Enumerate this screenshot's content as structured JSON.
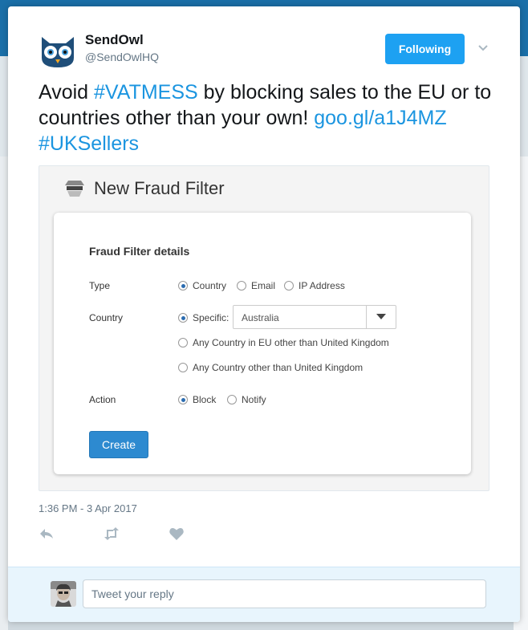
{
  "tweet": {
    "author_name": "SendOwl",
    "author_handle": "@SendOwlHQ",
    "follow_label": "Following",
    "text_part1": "Avoid ",
    "hashtag1": "#VATMESS",
    "text_part2": " by blocking sales to the EU or to countries other than your own! ",
    "link": "goo.gl/a1J4MZ",
    "hashtag2": "#UKSellers",
    "timestamp": "1:36 PM - 3 Apr 2017"
  },
  "media": {
    "title": "New Fraud Filter",
    "section_title": "Fraud Filter details",
    "type_label": "Type",
    "type_options": [
      "Country",
      "Email",
      "IP Address"
    ],
    "country_label": "Country",
    "specific_label": "Specific:",
    "country_value": "Australia",
    "option_eu": "Any Country in EU other than United Kingdom",
    "option_other": "Any Country other than United Kingdom",
    "action_label": "Action",
    "action_options": [
      "Block",
      "Notify"
    ],
    "create_label": "Create"
  },
  "reply": {
    "placeholder": "Tweet your reply"
  },
  "colors": {
    "accent": "#1da1f2",
    "link": "#1b95e0",
    "create_button": "#2d8ad0"
  },
  "icons": [
    "owl-avatar",
    "chevron-down-icon",
    "fraud-filter-icon",
    "reply-icon",
    "retweet-icon",
    "like-icon"
  ]
}
